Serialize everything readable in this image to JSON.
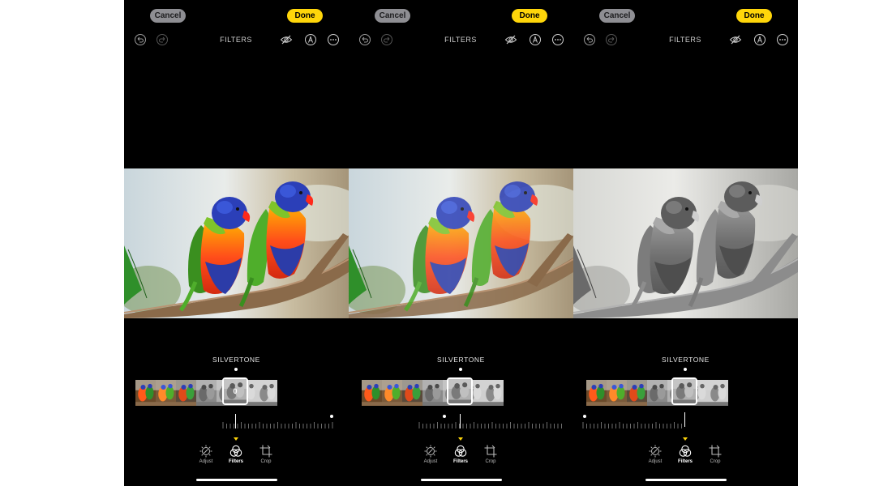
{
  "panels": [
    {
      "cancel_label": "Cancel",
      "done_label": "Done",
      "toolbar_title": "FILTERS",
      "filter_name": "SILVERTONE",
      "selected_value": "0",
      "filter_intensity_percent": 0,
      "photo_mode": "color",
      "tabs": {
        "adjust": "Adjust",
        "filters": "Filters",
        "crop": "Crop"
      }
    },
    {
      "cancel_label": "Cancel",
      "done_label": "Done",
      "toolbar_title": "FILTERS",
      "filter_name": "SILVERTONE",
      "selected_value": "",
      "filter_intensity_percent": 0,
      "photo_mode": "color-muted",
      "tabs": {
        "adjust": "Adjust",
        "filters": "Filters",
        "crop": "Crop"
      }
    },
    {
      "cancel_label": "Cancel",
      "done_label": "Done",
      "toolbar_title": "FILTERS",
      "filter_name": "SILVERTONE",
      "selected_value": "",
      "filter_intensity_percent": 100,
      "photo_mode": "silvertone",
      "tabs": {
        "adjust": "Adjust",
        "filters": "Filters",
        "crop": "Crop"
      }
    }
  ],
  "colors": {
    "accent_yellow": "#ffd60a",
    "cancel_gray": "#8e8e93",
    "background": "#000000"
  },
  "icons": [
    "undo-icon",
    "redo-icon",
    "hide-icon",
    "markup-icon",
    "more-icon",
    "adjust-icon",
    "filters-icon",
    "crop-icon"
  ]
}
